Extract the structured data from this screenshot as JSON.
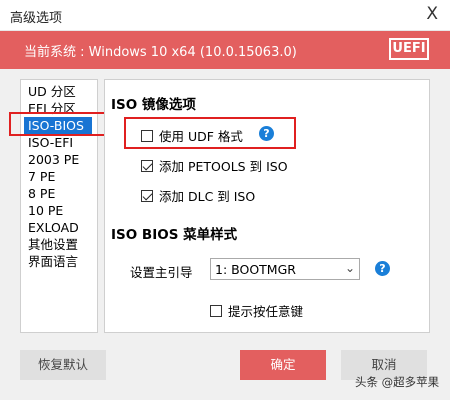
{
  "window": {
    "title": "高级选项",
    "close_glyph": "X"
  },
  "banner": {
    "system_info": "当前系统 : Windows 10 x64 (10.0.15063.0)",
    "badge": "UEFI"
  },
  "nav": {
    "items": [
      {
        "label": "UD 分区"
      },
      {
        "label": "EFI 分区"
      },
      {
        "label": "ISO-BIOS"
      },
      {
        "label": "ISO-EFI"
      },
      {
        "label": "2003 PE"
      },
      {
        "label": "7 PE"
      },
      {
        "label": "8 PE"
      },
      {
        "label": "10 PE"
      },
      {
        "label": "EXLOAD"
      },
      {
        "label": "其他设置"
      },
      {
        "label": "界面语言"
      }
    ],
    "selected_label": "ISO-BIOS"
  },
  "panel": {
    "iso_section_title": "ISO 镜像选项",
    "use_udf": {
      "label": "使用 UDF 格式",
      "checked": false
    },
    "add_petools": {
      "label": "添加 PETOOLS 到 ISO",
      "checked": true
    },
    "add_dlc": {
      "label": "添加 DLC 到 ISO",
      "checked": true
    },
    "bios_menu_title": "ISO BIOS 菜单样式",
    "boot_guide_label": "设置主引导",
    "boot_guide_value": "1: BOOTMGR",
    "show_key_hint": {
      "label": "提示按任意键",
      "checked": false
    },
    "help_glyph": "?"
  },
  "buttons": {
    "restore_default": "恢复默认",
    "ok": "确定",
    "cancel": "取消"
  },
  "colors": {
    "accent_red": "#e35f5f",
    "selected_blue": "#1874d3",
    "help_blue": "#1a7fd8",
    "highlight_red": "#e02020"
  },
  "watermark": "头条 @超多苹果"
}
